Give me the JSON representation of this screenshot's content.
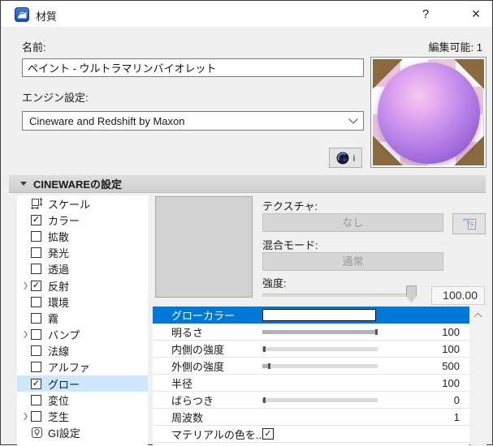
{
  "window": {
    "title": "材質",
    "help_label": "?",
    "close_label": "×"
  },
  "header": {
    "name_label": "名前:",
    "editable_label": "編集可能: 1",
    "name_value": "ペイント - ウルトラマリンバイオレット",
    "engine_label": "エンジン設定:",
    "engine_value": "Cineware and Redshift by Maxon",
    "c4d_info_label": "i"
  },
  "section": {
    "title": "CINEWAREの設定"
  },
  "channels": [
    {
      "label": "スケール",
      "icon": "scale",
      "checked": null,
      "expand": false,
      "selected": false
    },
    {
      "label": "カラー",
      "icon": null,
      "checked": true,
      "expand": false,
      "selected": false
    },
    {
      "label": "拡散",
      "icon": null,
      "checked": false,
      "expand": false,
      "selected": false
    },
    {
      "label": "発光",
      "icon": null,
      "checked": false,
      "expand": false,
      "selected": false
    },
    {
      "label": "透過",
      "icon": null,
      "checked": false,
      "expand": false,
      "selected": false
    },
    {
      "label": "反射",
      "icon": null,
      "checked": true,
      "expand": true,
      "selected": false
    },
    {
      "label": "環境",
      "icon": null,
      "checked": false,
      "expand": false,
      "selected": false
    },
    {
      "label": "霧",
      "icon": null,
      "checked": false,
      "expand": false,
      "selected": false
    },
    {
      "label": "バンプ",
      "icon": null,
      "checked": false,
      "expand": true,
      "selected": false
    },
    {
      "label": "法線",
      "icon": null,
      "checked": false,
      "expand": false,
      "selected": false
    },
    {
      "label": "アルファ",
      "icon": null,
      "checked": false,
      "expand": false,
      "selected": false
    },
    {
      "label": "グロー",
      "icon": null,
      "checked": true,
      "expand": false,
      "selected": true
    },
    {
      "label": "変位",
      "icon": null,
      "checked": false,
      "expand": false,
      "selected": false
    },
    {
      "label": "芝生",
      "icon": null,
      "checked": false,
      "expand": true,
      "selected": false
    },
    {
      "label": "GI設定",
      "icon": "lamp",
      "checked": null,
      "expand": false,
      "selected": false
    }
  ],
  "texture_panel": {
    "texture_label": "テクスチャ:",
    "texture_value": "なし",
    "blend_label": "混合モード:",
    "blend_value": "通常",
    "strength_label": "強度:",
    "strength_value": "100.00",
    "strength_percent": 97
  },
  "properties": [
    {
      "label": "グローカラー",
      "type": "color",
      "selected": true,
      "swatch_color": "#ffffff"
    },
    {
      "label": "明るさ",
      "type": "slider",
      "percent": 99,
      "value": "100"
    },
    {
      "label": "内側の強度",
      "type": "slider",
      "percent": 2,
      "value": "100"
    },
    {
      "label": "外側の強度",
      "type": "slider",
      "percent": 6,
      "value": "500"
    },
    {
      "label": "半径",
      "type": "value",
      "value": "100"
    },
    {
      "label": "ばらつき",
      "type": "slider",
      "percent": 2,
      "value": "0"
    },
    {
      "label": "周波数",
      "type": "value",
      "value": "1"
    },
    {
      "label": "マテリアルの色を...",
      "type": "checkbox",
      "checked": true,
      "value": ""
    }
  ],
  "colors": {
    "accent_blue": "#0078d7",
    "list_selection": "#cce8ff",
    "sphere_purple": "#9a64d8",
    "sphere_highlight": "#f6c9ef",
    "checker_pink": "#eec6da",
    "checker_brown": "#8a6a3e",
    "header_gray": "#d6d6d6"
  }
}
